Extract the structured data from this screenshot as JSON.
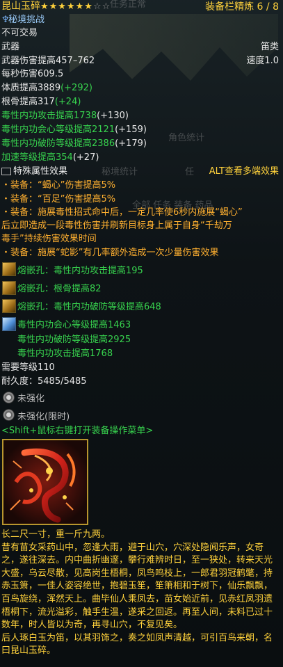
{
  "item": {
    "name": "昆山玉碎",
    "stars_on": "★★★★★★",
    "stars_off": "☆☆",
    "refine": "装备栏精炼 6 / 8",
    "source_tag": "秘境挑战",
    "trade": "不可交易",
    "type": "武器",
    "subtype": "笛类",
    "damage": "武器伤害提高457–762",
    "speed": "速度1.0",
    "dps": "每秒伤害609.5"
  },
  "stats": [
    {
      "base": "体质提高3889",
      "bonus": "(+292)",
      "color": "w"
    },
    {
      "base": "根骨提高317",
      "bonus": "(+24)",
      "color": "w"
    },
    {
      "base": "毒性内功攻击提高1738",
      "bonus": "(+130)",
      "color": "g"
    },
    {
      "base": "毒性内功会心等级提高2121",
      "bonus": "(+159)",
      "color": "g"
    },
    {
      "base": "毒性内功破防等级提高2386",
      "bonus": "(+179)",
      "color": "g"
    },
    {
      "base": "加速等级提高354",
      "bonus": "(+27)",
      "color": "g"
    }
  ],
  "special": {
    "header": "特殊属性效果",
    "alt_hint": "ALT查看多端效果",
    "effects": [
      "・装备：“蝎心”伤害提高5%",
      "・装备：“百足”伤害提高5%",
      "・装备：施展毒性招式命中后，一定几率使6秒内施展“蝎心”",
      "后立即造成一段毒性伤害并刷新目标身上属于自身“千劫万",
      "毒手”持续伤害效果时间",
      "・装备：施展“蛇影”有几率额外造成一次少量伤害效果"
    ]
  },
  "sockets": [
    "熔嵌孔：毒性内功攻击提高195",
    "熔嵌孔：根骨提高82",
    "熔嵌孔：毒性内功破防等级提高648"
  ],
  "enchant": [
    "毒性内功会心等级提高1463",
    "毒性内功破防等级提高2925",
    "毒性内功攻击提高1768"
  ],
  "requirements": {
    "level": "需要等级110",
    "durability": "耐久度：5485/5485"
  },
  "strengthen": [
    "未强化",
    "未强化(限时)"
  ],
  "shift_hint": "<Shift+鼠标右键打开装备操作菜单>",
  "ghost_ui": {
    "top": "任务正常",
    "role_stats": "角色统计",
    "dungeon_stats": "秘境统计",
    "ren": "任",
    "tabs": "全部   任务   装备   药品"
  },
  "lore": "长二尺一寸，重一斤九两。\n昔有苗女采药山中，忽逢大雨，避于山穴，穴深处隐闻乐声，女奇之，遂往深去。内中曲折幽邃，攀行难辨时日，至一狭处，转来天光大盛，乌云尽散，见高岗生梧桐，凤鸟鸣枝上，一郎君羽冠鹤氅，持赤玉箫，一佳人姿容绝世，抱碧玉笙，笙箫相和于树下，仙乐飘飘，百鸟旋绕，浑然天上。曲毕仙人乘凤去，苗女始近前，见赤红凤羽遗梧桐下，流光溢彩，触手生温，遂采之回返。再至人间，未料已过十数年，时人皆以为奇，再寻山穴，不复见矣。\n后人琢白玉为笛，以其羽饰之，奏之如凤声清越，可引百鸟来朝，名曰昆山玉碎。",
  "colors": {
    "gold": "#ffd23c",
    "green": "#37d24e",
    "orange": "#ffb030",
    "white": "#e8e8e8",
    "blue": "#9fd0ff"
  }
}
